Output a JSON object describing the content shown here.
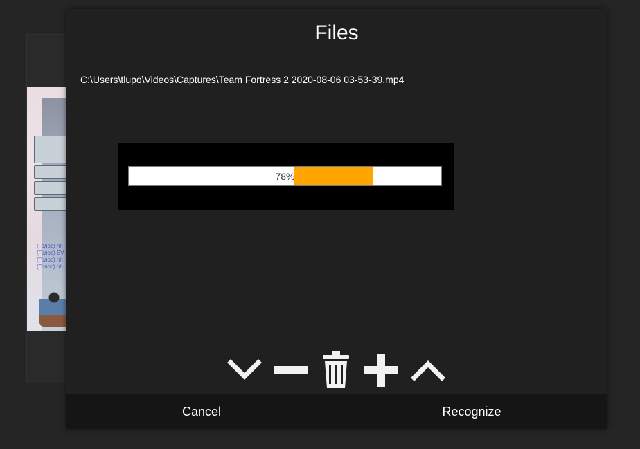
{
  "dialog": {
    "title": "Files",
    "file_path": "C:\\Users\\tlupo\\Videos\\Captures\\Team Fortress 2 2020-08-06 03-53-39.mp4"
  },
  "progress": {
    "value": 78,
    "label": "78%",
    "fill_color": "#ffa500"
  },
  "toolbar": {
    "icons": [
      "chevron-down-icon",
      "minus-icon",
      "trash-icon",
      "plus-icon",
      "chevron-up-icon"
    ],
    "icon_color": "#f2f2f2"
  },
  "footer": {
    "cancel_label": "Cancel",
    "recognize_label": "Recognize"
  },
  "background_window": {
    "chat_lines": [
      "(Голос) hh",
      "(Голос) EV",
      "(Голос) hh",
      "(Голос) hh"
    ]
  }
}
